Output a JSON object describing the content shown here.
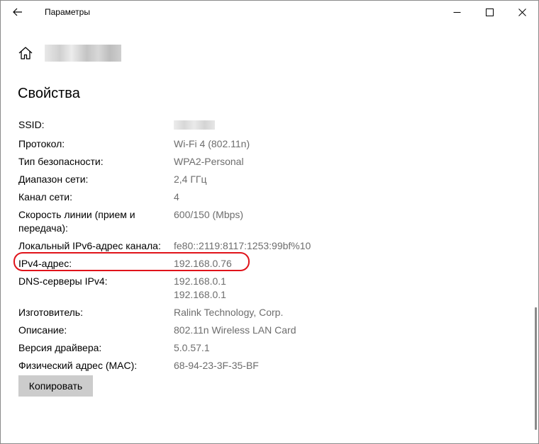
{
  "window": {
    "title": "Параметры"
  },
  "header": {
    "section_title": "Свойства"
  },
  "properties": [
    {
      "label": "SSID:",
      "value": ""
    },
    {
      "label": "Протокол:",
      "value": "Wi-Fi 4 (802.11n)"
    },
    {
      "label": "Тип безопасности:",
      "value": "WPA2-Personal"
    },
    {
      "label": "Диапазон сети:",
      "value": "2,4 ГГц"
    },
    {
      "label": "Канал сети:",
      "value": "4"
    },
    {
      "label": "Скорость линии (прием и передача):",
      "value": "600/150 (Mbps)"
    },
    {
      "label": "Локальный IPv6-адрес канала:",
      "value": "fe80::2119:8117:1253:99bf%10"
    },
    {
      "label": "IPv4-адрес:",
      "value": "192.168.0.76"
    },
    {
      "label": "DNS-серверы IPv4:",
      "values": [
        "192.168.0.1",
        "192.168.0.1"
      ]
    },
    {
      "label": "Изготовитель:",
      "value": "Ralink Technology, Corp."
    },
    {
      "label": "Описание:",
      "value": "802.11n Wireless LAN Card"
    },
    {
      "label": "Версия драйвера:",
      "value": "5.0.57.1"
    },
    {
      "label": "Физический адрес (MAC):",
      "value": "68-94-23-3F-35-BF"
    }
  ],
  "actions": {
    "copy_label": "Копировать"
  },
  "colors": {
    "highlight": "#e0131a",
    "value_text": "#6d6d6d",
    "button_bg": "#cccccc"
  },
  "icons": {
    "back": "arrow-left-icon",
    "home": "home-icon",
    "minimize": "minimize-icon",
    "maximize": "maximize-icon",
    "close": "close-icon"
  }
}
